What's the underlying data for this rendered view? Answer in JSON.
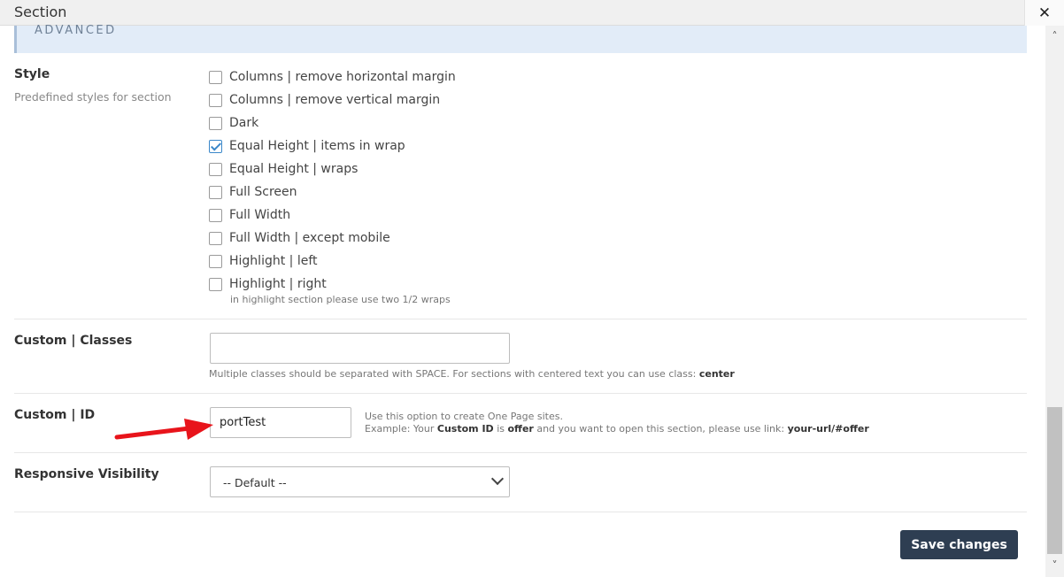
{
  "dialog": {
    "title": "Section",
    "close_symbol": "✕",
    "section_header": "ADVANCED"
  },
  "style": {
    "label": "Style",
    "description": "Predefined styles for section",
    "options": [
      {
        "label": "Columns | remove horizontal margin",
        "checked": false
      },
      {
        "label": "Columns | remove vertical margin",
        "checked": false
      },
      {
        "label": "Dark",
        "checked": false
      },
      {
        "label": "Equal Height | items in wrap",
        "checked": true
      },
      {
        "label": "Equal Height | wraps",
        "checked": false
      },
      {
        "label": "Full Screen",
        "checked": false
      },
      {
        "label": "Full Width",
        "checked": false
      },
      {
        "label": "Full Width | except mobile",
        "checked": false
      },
      {
        "label": "Highlight | left",
        "checked": false
      },
      {
        "label": "Highlight | right",
        "checked": false
      }
    ],
    "note": "in highlight section please use two 1/2 wraps"
  },
  "custom_classes": {
    "label": "Custom | Classes",
    "value": "",
    "hint_text": "Multiple classes should be separated with SPACE. For sections with centered text you can use class: ",
    "hint_bold": "center"
  },
  "custom_id": {
    "label": "Custom | ID",
    "value": "portTest",
    "hint_line1": "Use this option to create One Page sites.",
    "hint_line2_a": "Example: Your ",
    "hint_line2_b": "Custom ID",
    "hint_line2_c": " is ",
    "hint_line2_d": "offer",
    "hint_line2_e": " and you want to open this section, please use link: ",
    "hint_line2_f": "your-url/#offer"
  },
  "responsive": {
    "label": "Responsive Visibility",
    "selected": "-- Default --"
  },
  "footer": {
    "save_label": "Save changes"
  },
  "colors": {
    "accent": "#3a87c9",
    "button_bg": "#2e3e52",
    "annotation_arrow": "#e8141b"
  }
}
